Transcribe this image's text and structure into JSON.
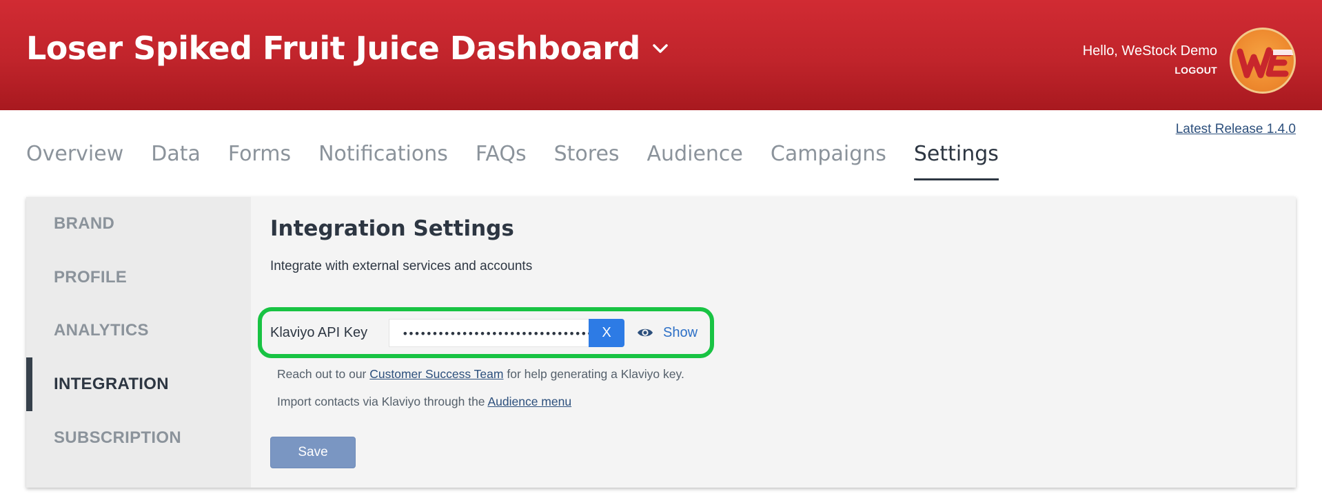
{
  "header": {
    "title": "Loser Spiked Fruit Juice Dashboard",
    "greeting": "Hello, WeStock Demo",
    "logout_label": "LOGOUT",
    "avatar_alt": "WeStock logo",
    "brand_color": "#c0242b"
  },
  "release": {
    "label": "Latest Release 1.4.0"
  },
  "tabs": [
    {
      "label": "Overview"
    },
    {
      "label": "Data"
    },
    {
      "label": "Forms"
    },
    {
      "label": "Notifications"
    },
    {
      "label": "FAQs"
    },
    {
      "label": "Stores"
    },
    {
      "label": "Audience"
    },
    {
      "label": "Campaigns"
    },
    {
      "label": "Settings",
      "active": true
    }
  ],
  "sidebar": {
    "items": [
      {
        "label": "BRAND"
      },
      {
        "label": "PROFILE"
      },
      {
        "label": "ANALYTICS"
      },
      {
        "label": "INTEGRATION",
        "active": true
      },
      {
        "label": "SUBSCRIPTION"
      }
    ]
  },
  "integration": {
    "title": "Integration Settings",
    "description": "Integrate with external services and accounts",
    "klaviyo": {
      "label": "Klaviyo API Key",
      "masked_value": "••••••••••••••••••••••••••••••••••••",
      "clear_label": "X",
      "show_label": "Show",
      "highlight_color": "#18c343"
    },
    "help1": {
      "prefix": "Reach out to our",
      "link": "Customer Success Team",
      "suffix": "for help generating a Klaviyo key."
    },
    "help2": {
      "prefix": "Import contacts via Klaviyo through the",
      "link": "Audience menu"
    },
    "save_label": "Save"
  }
}
